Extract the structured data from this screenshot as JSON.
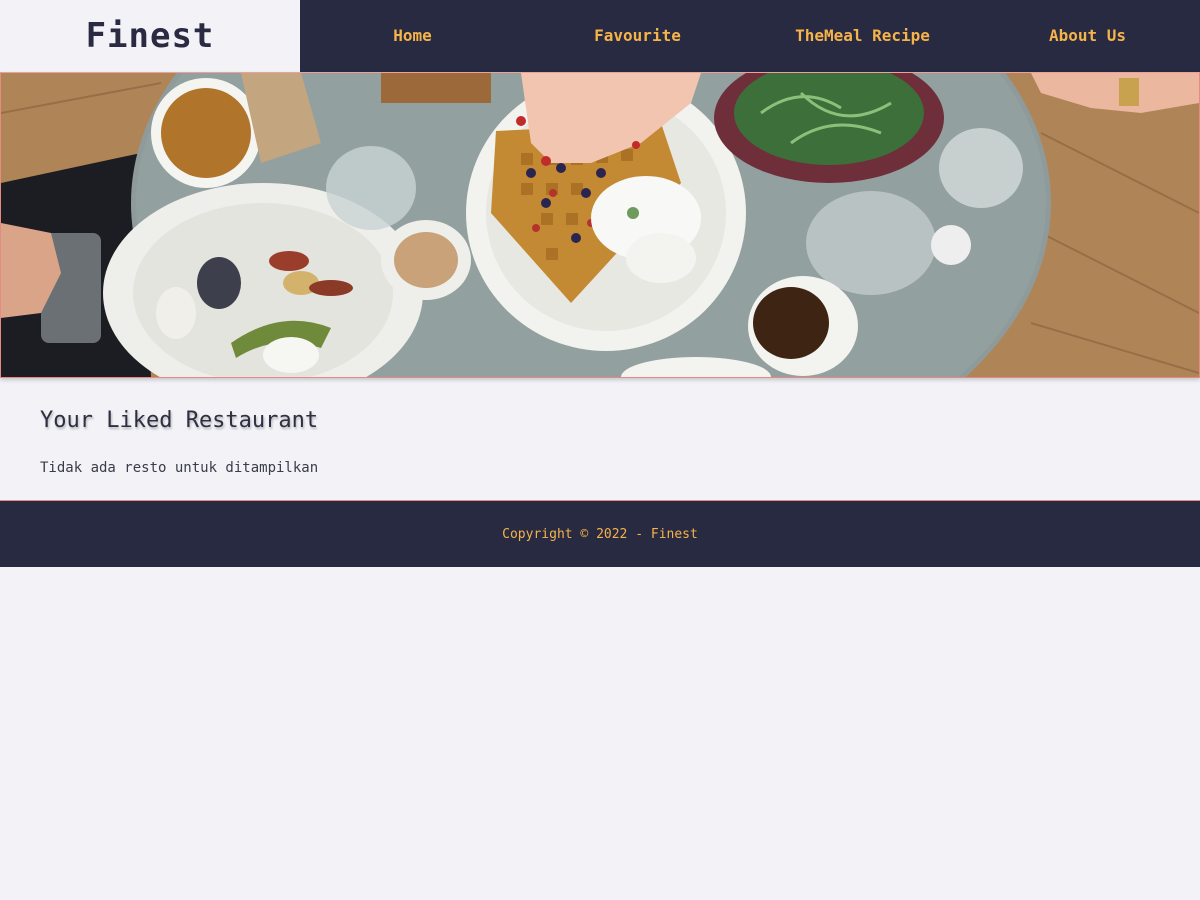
{
  "header": {
    "brand": "Finest",
    "nav": [
      {
        "label": "Home"
      },
      {
        "label": "Favourite"
      },
      {
        "label": "TheMeal Recipe"
      },
      {
        "label": "About Us"
      }
    ]
  },
  "hero": {
    "image": "top-down-breakfast-table-photo"
  },
  "main": {
    "title": "Your Liked Restaurant",
    "empty_message": "Tidak ada resto untuk ditampilkan"
  },
  "footer": {
    "copyright": "Copyright © 2022 - Finest"
  },
  "colors": {
    "nav_bg": "#272a41",
    "accent": "#f6b34a",
    "page_bg": "#f2f2f7",
    "border_accent": "#e58b83"
  }
}
